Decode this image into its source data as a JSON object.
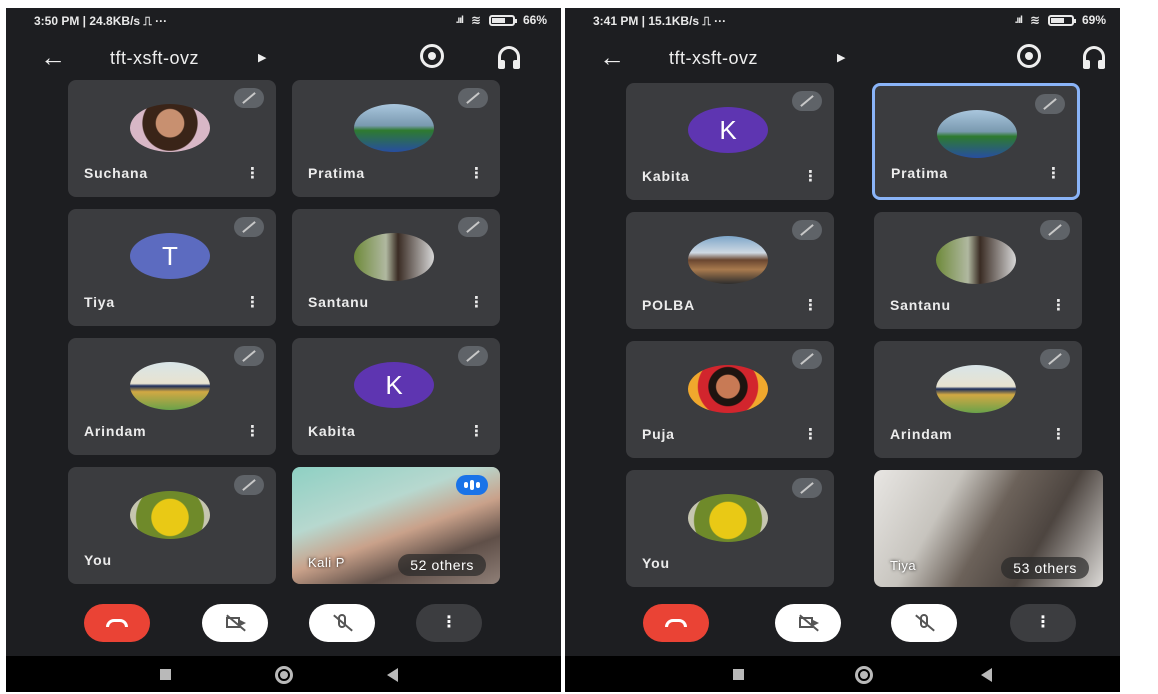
{
  "colors": {
    "background": "#1d1e21",
    "tile": "#3b3c3f",
    "end_call": "#ea4335",
    "active_border": "#8ab4f8",
    "avatar_tiya": "#5c6bc0",
    "avatar_kabita": "#5e35b1"
  },
  "left": {
    "status": {
      "time": "3:50 PM | 24.8KB/s ⎍ ···",
      "signal": ".ııl",
      "wifi": "≋",
      "battery": "66%"
    },
    "meeting_code": "tft-xsft-ovz",
    "tiles": [
      {
        "name": "Suchana",
        "avatar": "photo"
      },
      {
        "name": "Pratima",
        "avatar": "photo"
      },
      {
        "name": "Tiya",
        "avatar": "letter",
        "letter": "T"
      },
      {
        "name": "Santanu",
        "avatar": "photo"
      },
      {
        "name": "Arindam",
        "avatar": "photo"
      },
      {
        "name": "Kabita",
        "avatar": "letter",
        "letter": "K"
      },
      {
        "name": "You",
        "avatar": "photo"
      }
    ],
    "video_tile": {
      "name": "Kali P",
      "others": "52 others"
    }
  },
  "right": {
    "status": {
      "time": "3:41 PM | 15.1KB/s ⎍ ···",
      "signal": ".ııl",
      "wifi": "≋",
      "battery": "69%"
    },
    "meeting_code": "tft-xsft-ovz",
    "tiles": [
      {
        "name": "Kabita",
        "avatar": "letter",
        "letter": "K"
      },
      {
        "name": "Pratima",
        "avatar": "photo"
      },
      {
        "name": "POLBA",
        "avatar": "photo"
      },
      {
        "name": "Santanu",
        "avatar": "photo"
      },
      {
        "name": "Puja",
        "avatar": "photo"
      },
      {
        "name": "Arindam",
        "avatar": "photo"
      },
      {
        "name": "You",
        "avatar": "photo"
      }
    ],
    "video_tile": {
      "name": "Tiya",
      "others": "53 others"
    }
  },
  "icons": {
    "back": "back-arrow-icon",
    "flip_camera": "flip-camera-icon",
    "audio_output": "headset-icon",
    "muted": "mic-off-icon",
    "more": "more-vert-icon",
    "end_call": "end-call-icon",
    "camera_off": "camera-off-icon",
    "mic_off": "mic-off-icon",
    "speaking": "speaking-indicator-icon"
  }
}
